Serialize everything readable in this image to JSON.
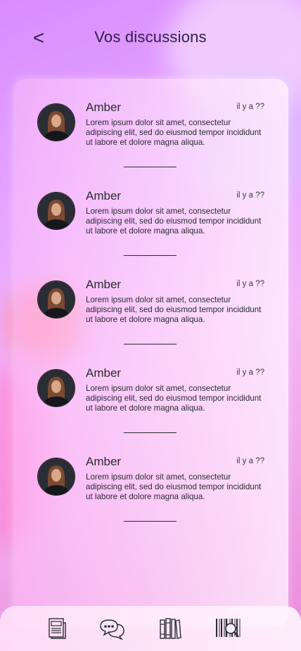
{
  "header": {
    "back_label": "<",
    "title": "Vos discussions"
  },
  "conversations": [
    {
      "name": "Amber",
      "time": "il y a ??",
      "message": "Lorem ipsum dolor sit amet, consectetur adipiscing elit, sed do eiusmod tempor incididunt ut labore et dolore magna aliqua."
    },
    {
      "name": "Amber",
      "time": "il y a ??",
      "message": "Lorem ipsum dolor sit amet, consectetur adipiscing elit, sed do eiusmod tempor incididunt ut labore et dolore magna aliqua."
    },
    {
      "name": "Amber",
      "time": "il y a ??",
      "message": "Lorem ipsum dolor sit amet, consectetur adipiscing elit, sed do eiusmod tempor incididunt ut labore et dolore magna aliqua."
    },
    {
      "name": "Amber",
      "time": "il y a ??",
      "message": "Lorem ipsum dolor sit amet, consectetur adipiscing elit, sed do eiusmod tempor incididunt ut labore et dolore magna aliqua."
    },
    {
      "name": "Amber",
      "time": "il y a ??",
      "message": "Lorem ipsum dolor sit amet, consectetur adipiscing elit, sed do eiusmod tempor incididunt ut labore et dolore magna aliqua."
    }
  ],
  "nav": {
    "icons": [
      "news-icon",
      "chat-icon",
      "library-icon",
      "barcode-search-icon"
    ]
  }
}
